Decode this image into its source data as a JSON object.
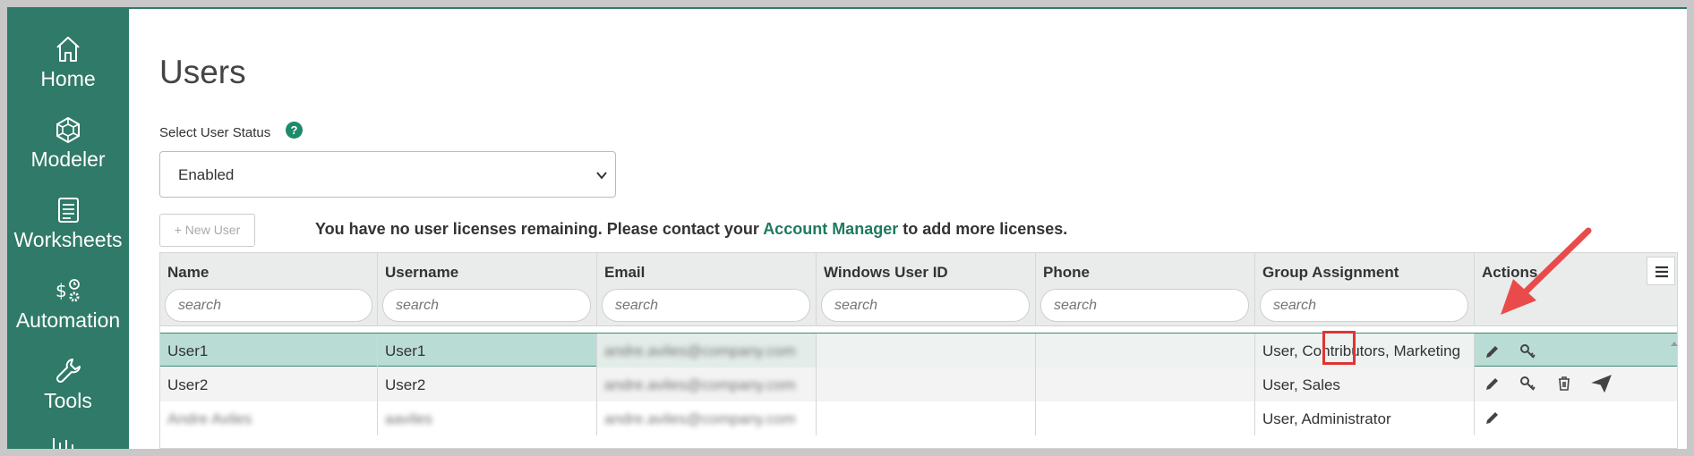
{
  "sidebar": {
    "items": [
      {
        "label": "Home",
        "icon": "home-icon"
      },
      {
        "label": "Modeler",
        "icon": "cube-network-icon"
      },
      {
        "label": "Worksheets",
        "icon": "worksheet-icon"
      },
      {
        "label": "Automation",
        "icon": "dollar-gear-icon"
      },
      {
        "label": "Tools",
        "icon": "wrench-icon"
      }
    ]
  },
  "page": {
    "title": "Users",
    "status_label": "Select User Status",
    "help_icon_text": "?",
    "status_value": "Enabled"
  },
  "toolbar": {
    "new_user_label": "+ New User",
    "license_before": "You have no user licenses remaining. Please contact your ",
    "license_link": "Account Manager",
    "license_after": " to add more licenses."
  },
  "grid": {
    "columns": [
      {
        "title": "Name",
        "search_placeholder": "search"
      },
      {
        "title": "Username",
        "search_placeholder": "search"
      },
      {
        "title": "Email",
        "search_placeholder": "search"
      },
      {
        "title": "Windows User ID",
        "search_placeholder": "search"
      },
      {
        "title": "Phone",
        "search_placeholder": "search"
      },
      {
        "title": "Group Assignment",
        "search_placeholder": "search"
      },
      {
        "title": "Actions"
      }
    ],
    "rows": [
      {
        "name": "User1",
        "username": "User1",
        "email": "andre.aviles@company.com",
        "windows_id": "",
        "phone": "",
        "groups": "User, Contributors, Marketing",
        "actions": [
          "edit",
          "key"
        ]
      },
      {
        "name": "User2",
        "username": "User2",
        "email": "andre.aviles@company.com",
        "windows_id": "",
        "phone": "",
        "groups": "User, Sales",
        "actions": [
          "edit",
          "key",
          "delete",
          "send"
        ]
      },
      {
        "name": "Andre Aviles",
        "username": "aaviles",
        "email": "andre.aviles@company.com",
        "windows_id": "",
        "phone": "",
        "groups": "User, Administrator",
        "actions": [
          "edit"
        ]
      }
    ]
  },
  "colors": {
    "sidebar": "#2f7a68",
    "accent": "#1e7a5f",
    "selected_row": "#b9ddd4",
    "annotation": "#e03434"
  }
}
